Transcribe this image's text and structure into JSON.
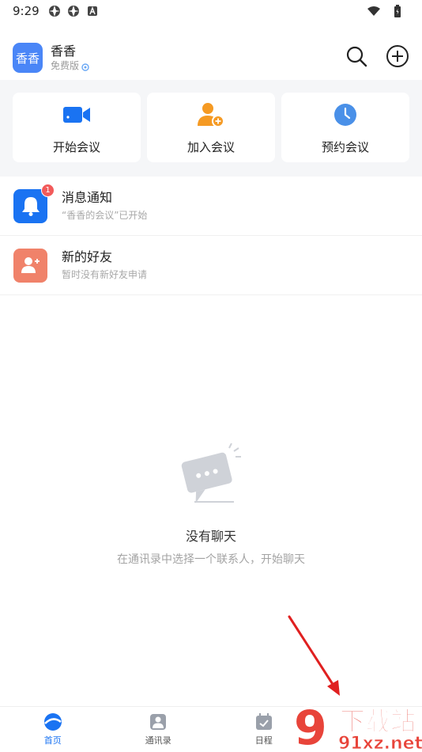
{
  "status_bar": {
    "time": "9:29",
    "left_icons": [
      "aperture-icon",
      "aperture-icon",
      "app-icon"
    ],
    "right_icons": [
      "wifi-icon",
      "battery-icon"
    ]
  },
  "header": {
    "avatar_text": "香香",
    "user_name": "香香",
    "plan": "免费版",
    "actions": [
      "search-icon",
      "add-circle-icon"
    ]
  },
  "quick_actions": [
    {
      "label": "开始会议",
      "icon": "video-camera-icon",
      "color": "#1a73f2"
    },
    {
      "label": "加入会议",
      "icon": "add-person-icon",
      "color": "#f59a23"
    },
    {
      "label": "预约会议",
      "icon": "clock-icon",
      "color": "#4a90e8"
    }
  ],
  "list": [
    {
      "title": "消息通知",
      "subtitle": "“香香的会议”已开始",
      "badge": "1",
      "icon": "bell-icon"
    },
    {
      "title": "新的好友",
      "subtitle": "暂时没有新好友申请",
      "icon": "add-friend-icon"
    }
  ],
  "empty_state": {
    "title": "没有聊天",
    "subtitle": "在通讯录中选择一个联系人，开始聊天"
  },
  "bottom_nav": [
    {
      "label": "首页",
      "icon": "home-icon",
      "active": true
    },
    {
      "label": "通讯录",
      "icon": "contacts-icon",
      "active": false
    },
    {
      "label": "日程",
      "icon": "calendar-icon",
      "active": false
    }
  ],
  "watermark": {
    "logo": "9",
    "brand": "下载站",
    "domain": "91xz.net"
  },
  "colors": {
    "accent": "#1a73f2",
    "panel_bg": "#f5f6f8",
    "badge": "#f25a5a",
    "annotation": "#e02020"
  }
}
